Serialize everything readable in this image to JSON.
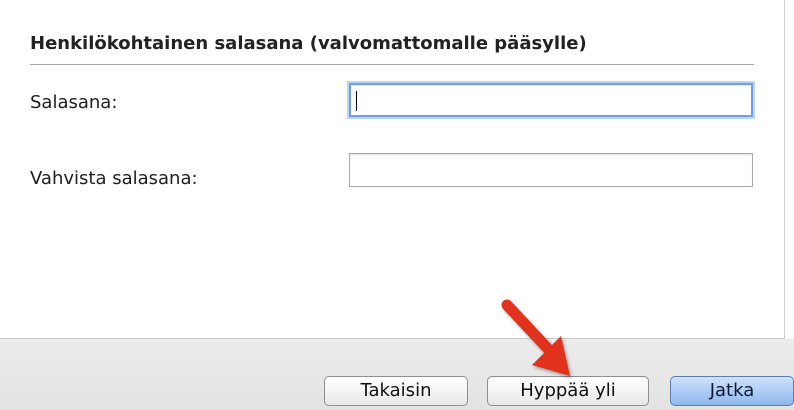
{
  "section": {
    "title": "Henkilökohtainen salasana (valvomattomalle pääsylle)"
  },
  "fields": {
    "password_label": "Salasana:",
    "password_value": "",
    "confirm_label": "Vahvista salasana:",
    "confirm_value": ""
  },
  "buttons": {
    "back": "Takaisin",
    "skip": "Hyppää yli",
    "continue": "Jatka"
  },
  "annotation": {
    "arrow_icon": "red-arrow-icon",
    "arrow_color": "#e0321e"
  }
}
